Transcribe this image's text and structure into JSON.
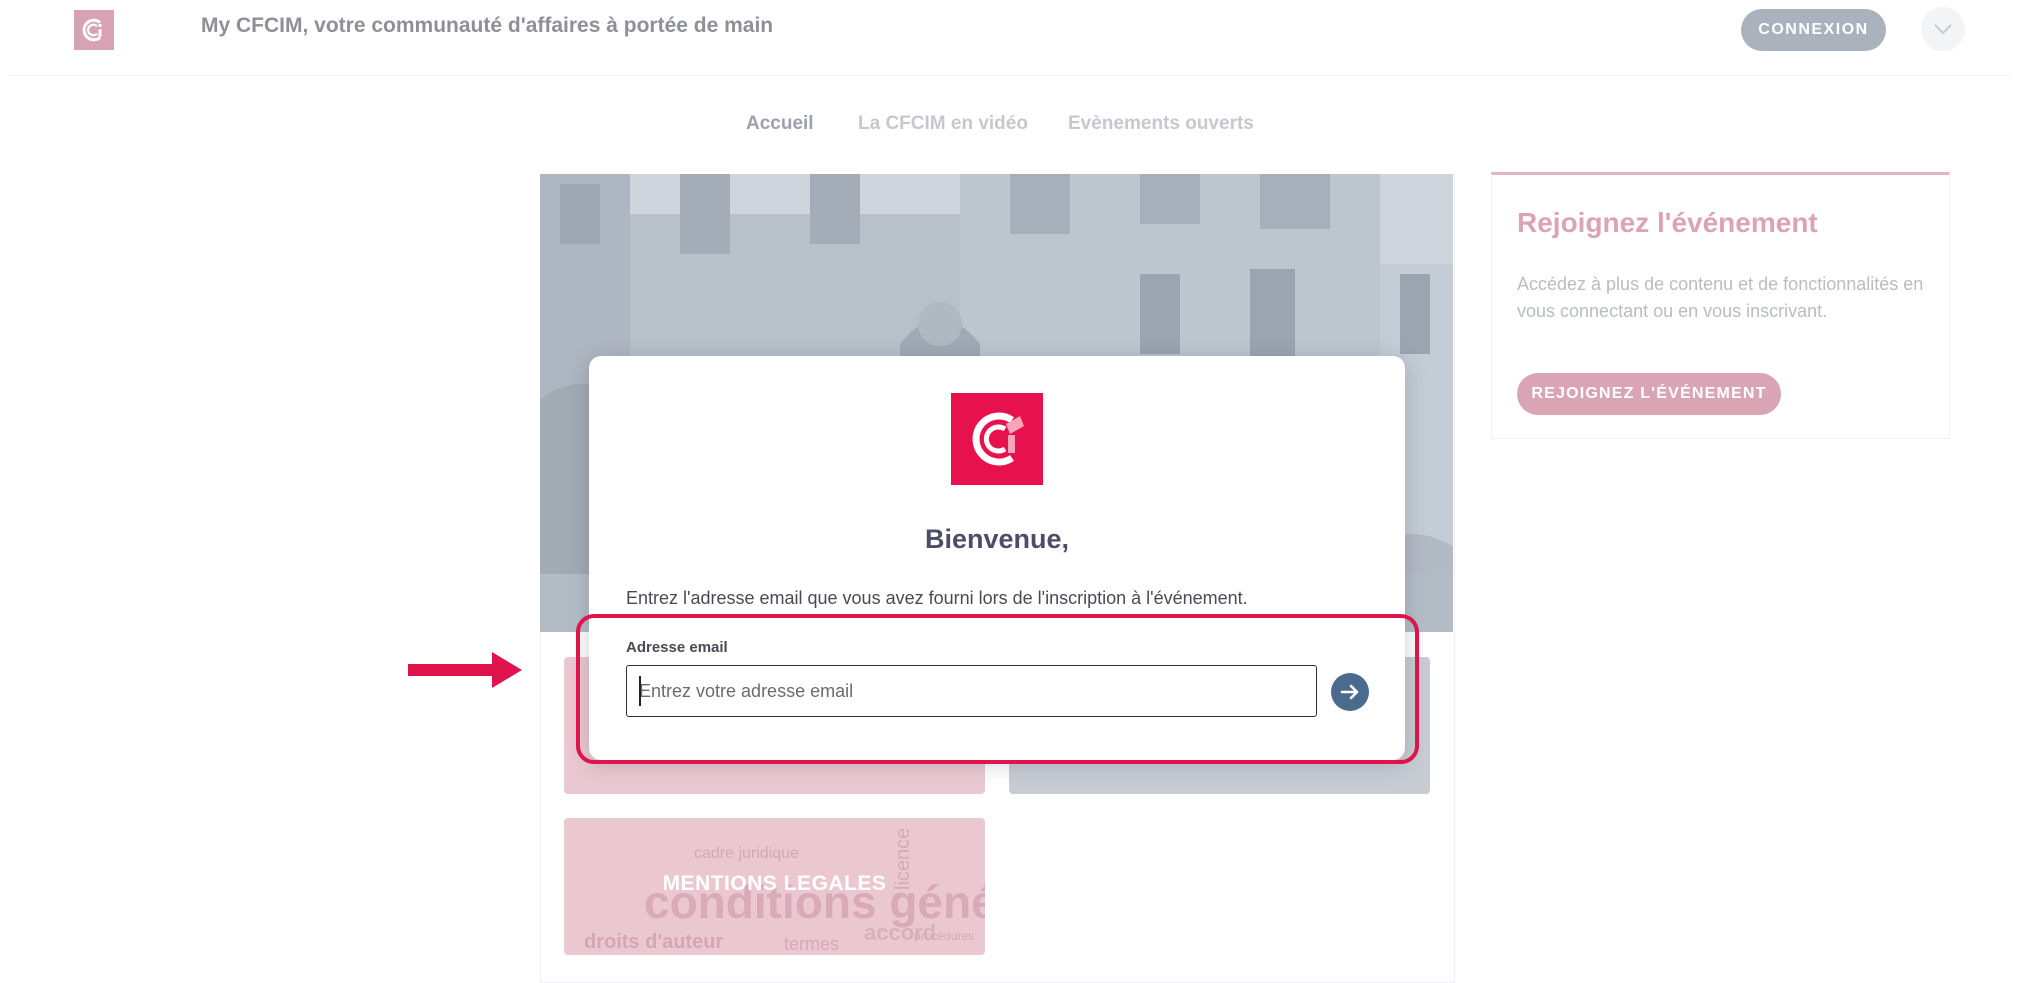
{
  "header": {
    "site_title": "My CFCIM, votre communauté d'affaires à portée de main",
    "connexion_label": "CONNEXION",
    "logo_icon": "cfcim-logo-icon",
    "dropdown_icon": "chevron-down-icon"
  },
  "nav": {
    "tabs": [
      {
        "label": "Accueil",
        "active": true
      },
      {
        "label": "La CFCIM en vidéo",
        "active": false
      },
      {
        "label": "Evènements ouverts",
        "active": false
      }
    ]
  },
  "tiles": {
    "mentions_label": "MENTIONS LEGALES",
    "wordcloud_text": [
      "conditions générales",
      "droits d'auteur",
      "termes",
      "accord",
      "licence",
      "cadre juridique",
      "procédures"
    ]
  },
  "sidebar": {
    "title": "Rejoignez l'événement",
    "text": "Accédez à plus de contenu et de fonctionnalités en vous connectant ou en vous inscrivant.",
    "join_button": "REJOIGNEZ L'ÉVÉNEMENT"
  },
  "modal": {
    "title": "Bienvenue,",
    "instructions": "Entrez l'adresse email que vous avez fourni lors de l'inscription à l'événement.",
    "email_label": "Adresse email",
    "email_placeholder": "Entrez votre adresse email",
    "email_value": "",
    "submit_icon": "arrow-right-icon"
  },
  "colors": {
    "brand": "#e6114d",
    "submit": "#4a6b8d",
    "annotation": "#e0134d"
  }
}
